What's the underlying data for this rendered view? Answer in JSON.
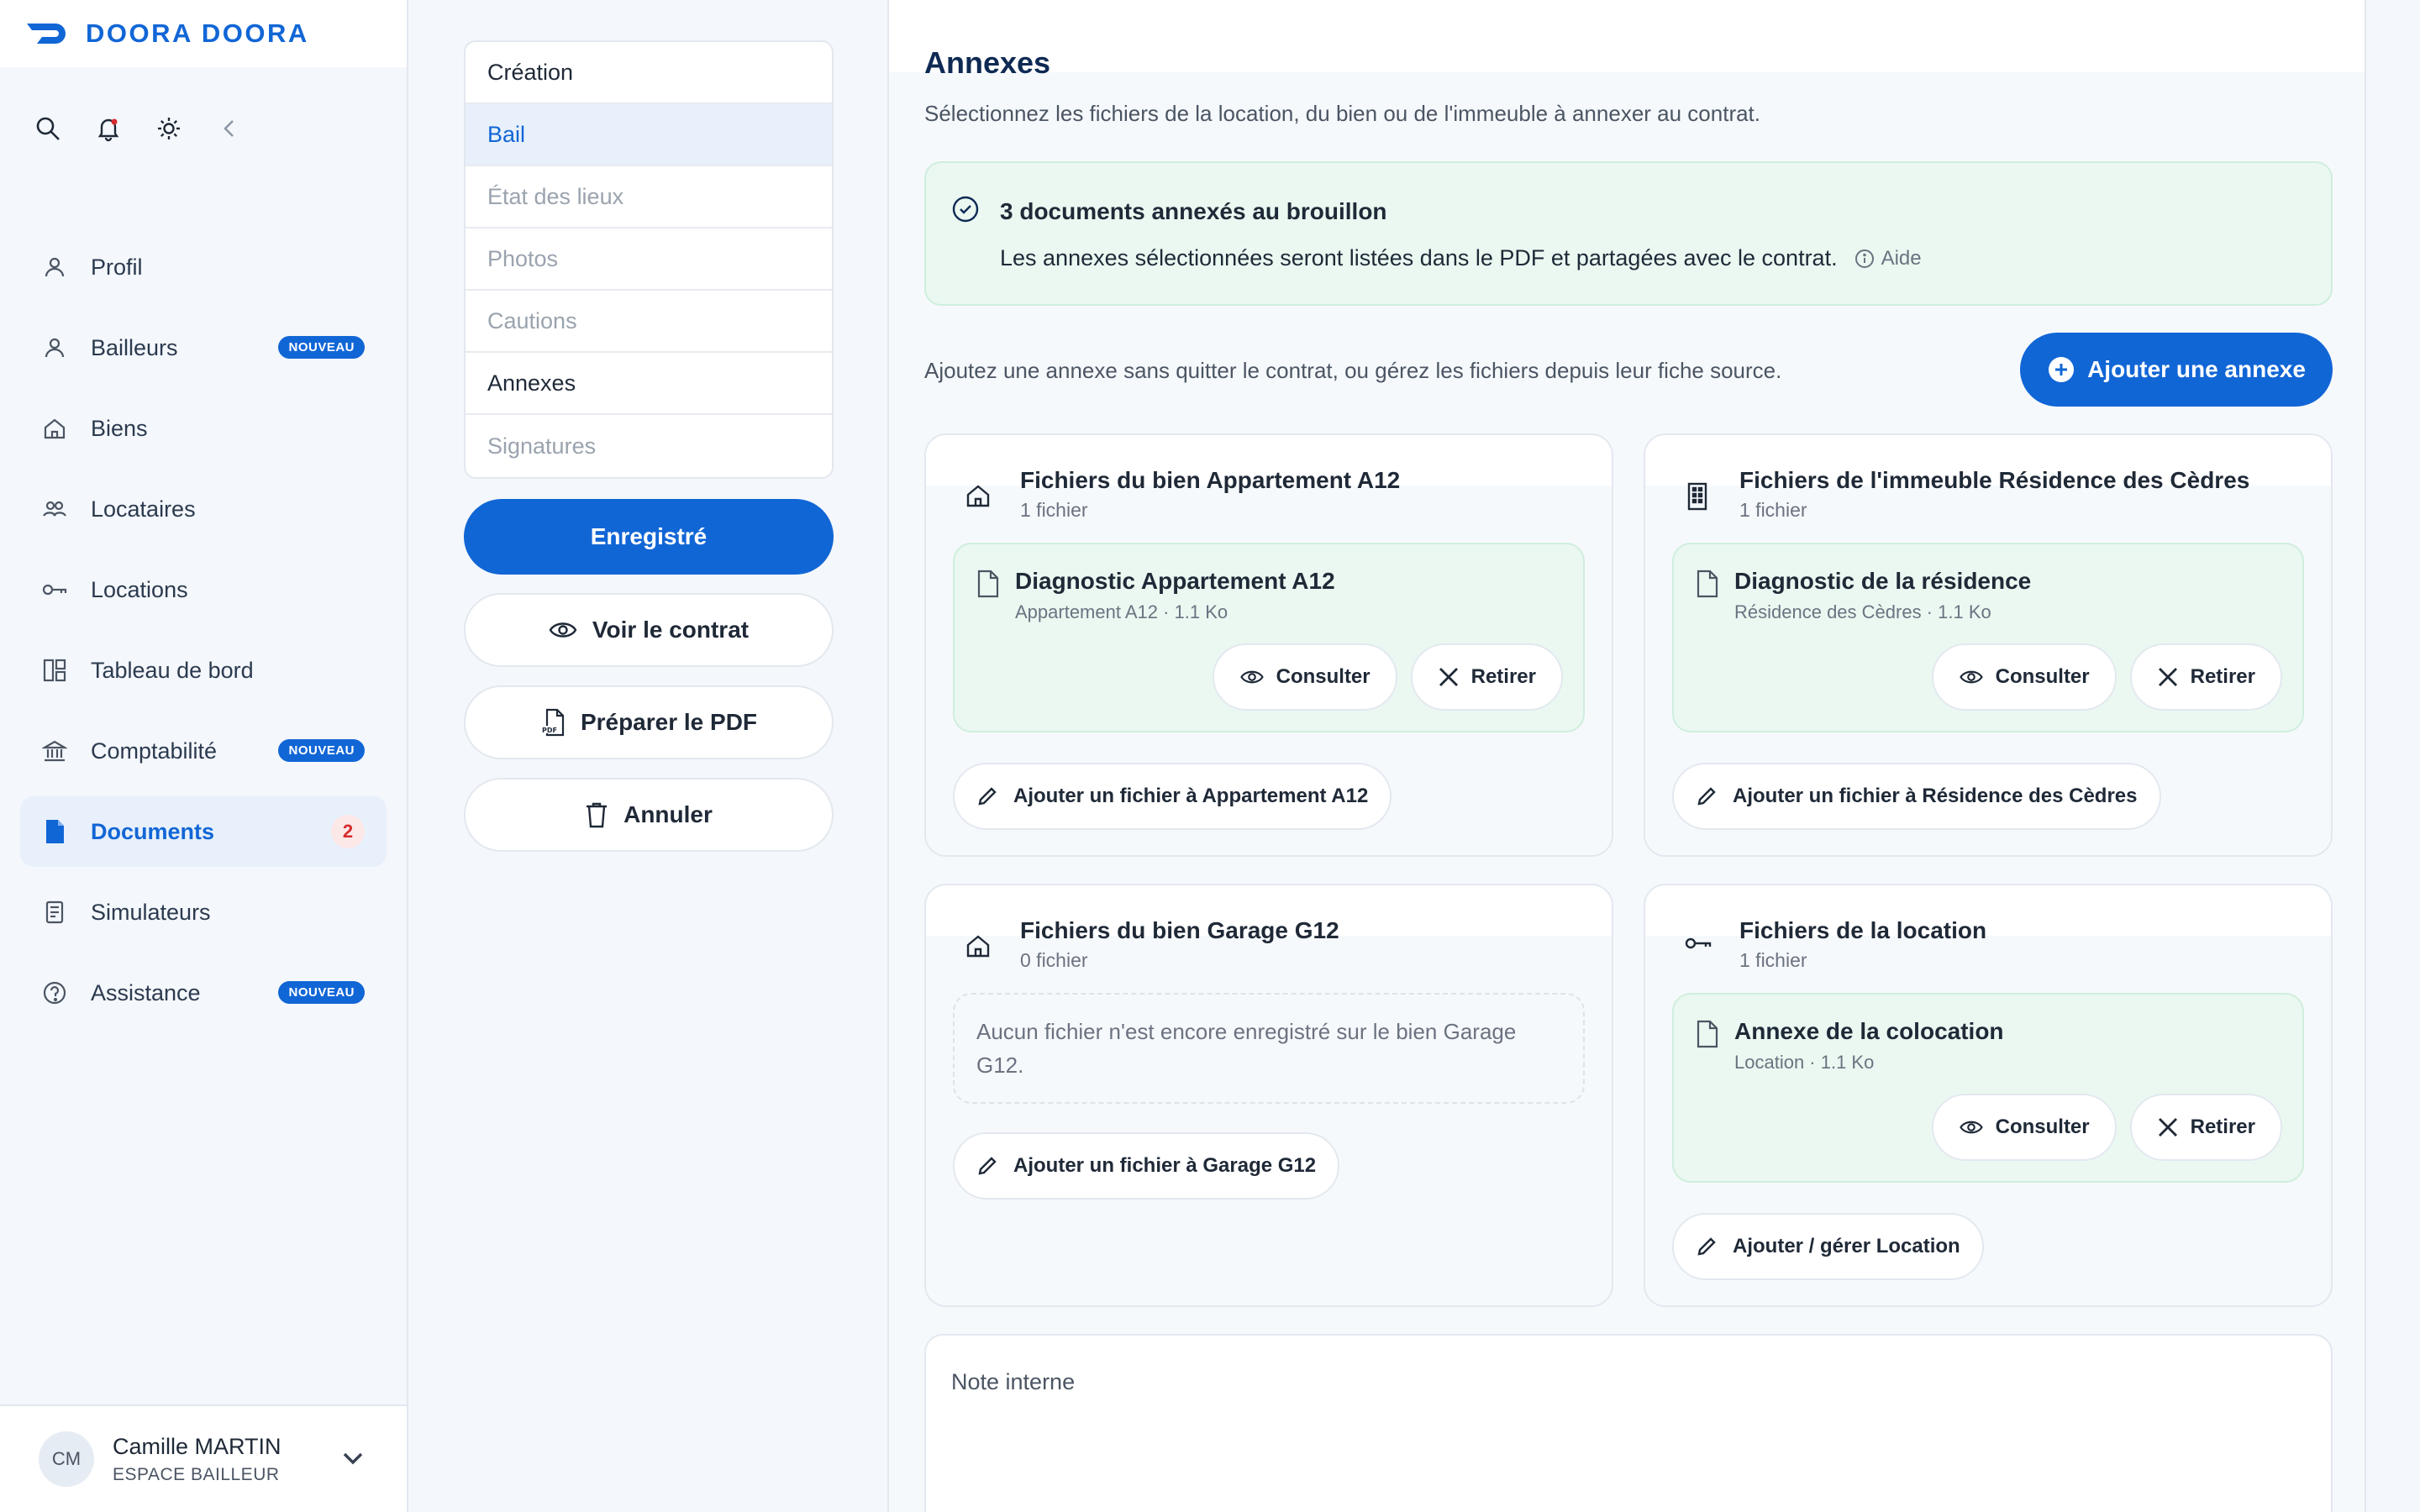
{
  "brand": {
    "name": "DOORA DOORA",
    "color": "#1166d6"
  },
  "sidebar": {
    "top_icons": [
      "search-icon",
      "bell-icon",
      "sun-icon",
      "collapse-icon"
    ],
    "items": [
      {
        "label": "Profil",
        "icon": "user-icon"
      },
      {
        "label": "Bailleurs",
        "icon": "user-icon",
        "badge": "NOUVEAU"
      },
      {
        "label": "Biens",
        "icon": "home-icon"
      },
      {
        "label": "Locataires",
        "icon": "users-icon"
      },
      {
        "label": "Locations",
        "icon": "key-icon"
      },
      {
        "label": "Tableau de bord",
        "icon": "dashboard-icon"
      },
      {
        "label": "Comptabilité",
        "icon": "bank-icon",
        "badge": "NOUVEAU"
      },
      {
        "label": "Documents",
        "icon": "document-icon",
        "count": "2",
        "active": true
      },
      {
        "label": "Simulateurs",
        "icon": "calculator-icon"
      },
      {
        "label": "Assistance",
        "icon": "help-icon",
        "badge": "NOUVEAU"
      }
    ],
    "user": {
      "initials": "CM",
      "name": "Camille MARTIN",
      "role": "ESPACE BAILLEUR"
    }
  },
  "steps": [
    {
      "label": "Création",
      "state": "done"
    },
    {
      "label": "Bail",
      "state": "selected"
    },
    {
      "label": "État des lieux",
      "state": "disabled"
    },
    {
      "label": "Photos",
      "state": "disabled"
    },
    {
      "label": "Cautions",
      "state": "disabled"
    },
    {
      "label": "Annexes",
      "state": "current"
    },
    {
      "label": "Signatures",
      "state": "disabled"
    }
  ],
  "actions": {
    "save": "Enregistré",
    "view_contract": "Voir le contrat",
    "prepare_pdf": "Préparer le PDF",
    "cancel": "Annuler"
  },
  "main": {
    "title": "Annexes",
    "subtitle": "Sélectionnez les fichiers de la location, du bien ou de l'immeuble à annexer au contrat.",
    "alert": {
      "title": "3 documents annexés au brouillon",
      "text": "Les annexes sélectionnées seront listées dans le PDF et partagées avec le contrat.",
      "help": "Aide"
    },
    "hint": "Ajoutez une annexe sans quitter le contrat, ou gérez les fichiers depuis leur fiche source.",
    "add_button": "Ajouter une annexe",
    "cards": [
      {
        "title": "Fichiers du bien Appartement A12",
        "count": "1 fichier",
        "icon": "home-icon",
        "file": {
          "name": "Diagnostic Appartement A12",
          "meta": "Appartement A12 · 1.1 Ko"
        },
        "link": "Ajouter un fichier à Appartement A12"
      },
      {
        "title": "Fichiers de l'immeuble Résidence des Cèdres",
        "count": "1 fichier",
        "icon": "building-icon",
        "file": {
          "name": "Diagnostic de la résidence",
          "meta": "Résidence des Cèdres · 1.1 Ko"
        },
        "link": "Ajouter un fichier à Résidence des Cèdres"
      },
      {
        "title": "Fichiers du bien Garage G12",
        "count": "0 fichier",
        "icon": "home-icon",
        "empty": "Aucun fichier n'est encore enregistré sur le bien Garage G12.",
        "link": "Ajouter un fichier à Garage G12"
      },
      {
        "title": "Fichiers de la location",
        "count": "1 fichier",
        "icon": "key-icon",
        "file": {
          "name": "Annexe de la colocation",
          "meta": "Location · 1.1 Ko"
        },
        "link": "Ajouter / gérer Location"
      }
    ],
    "file_actions": {
      "view": "Consulter",
      "remove": "Retirer"
    },
    "note_label": "Note interne"
  }
}
